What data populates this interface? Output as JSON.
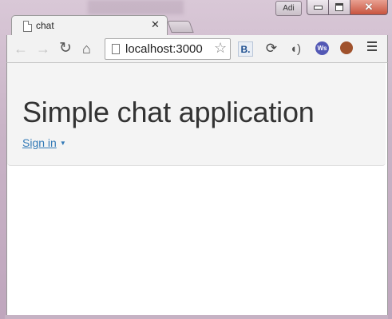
{
  "window": {
    "profile_label": "Adi",
    "controls": [
      "minimize",
      "maximize",
      "close"
    ]
  },
  "tabs": [
    {
      "title": "chat",
      "active": true,
      "icon": "page-icon"
    }
  ],
  "toolbar": {
    "address": "localhost:3000",
    "icons": [
      "back-icon",
      "forward-icon",
      "reload-icon",
      "home-icon",
      "star-icon"
    ],
    "extensions": [
      {
        "name": "b-extension-icon",
        "label": "B."
      },
      {
        "name": "sync-icon",
        "label": ""
      },
      {
        "name": "audio-icon",
        "label": ""
      },
      {
        "name": "ws-extension-icon",
        "label": "Ws"
      },
      {
        "name": "basketball-icon",
        "label": ""
      }
    ]
  },
  "page": {
    "heading": "Simple chat application",
    "signin_label": "Sign in",
    "link_color": "#337ab7"
  }
}
